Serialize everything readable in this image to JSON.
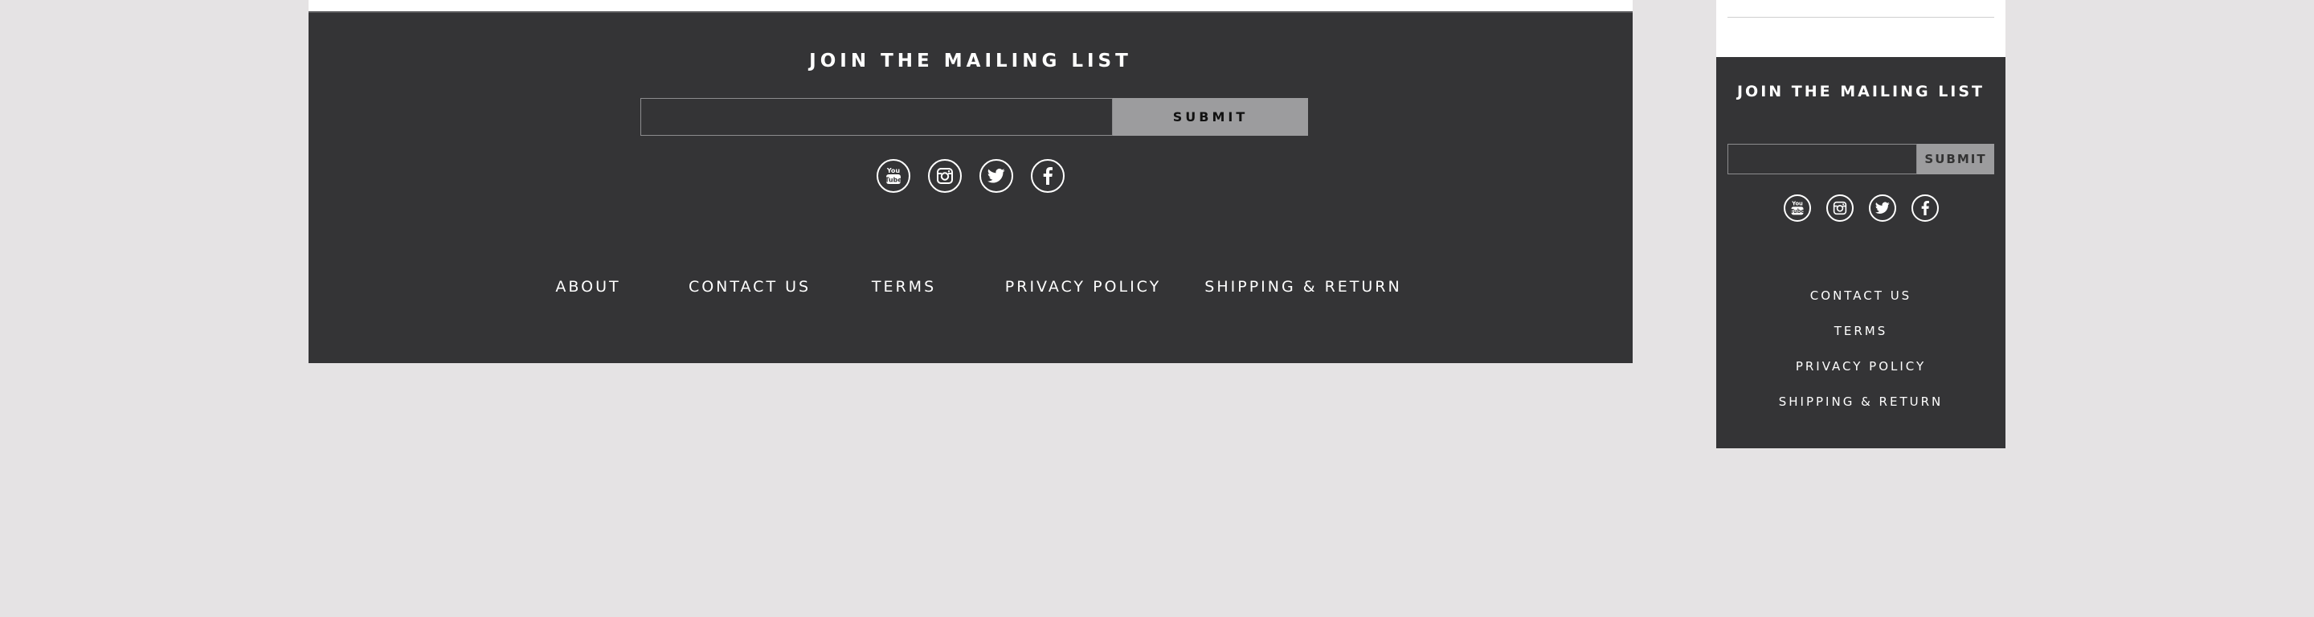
{
  "desktop_footer": {
    "mailing_title": "JOIN THE MAILING LIST",
    "email_input": {
      "value": "",
      "placeholder": ""
    },
    "submit_label": "SUBMIT",
    "socials": [
      {
        "icon": "youtube-icon"
      },
      {
        "icon": "instagram-icon"
      },
      {
        "icon": "twitter-icon"
      },
      {
        "icon": "facebook-icon"
      }
    ],
    "nav": [
      {
        "label": "ABOUT"
      },
      {
        "label": "CONTACT US"
      },
      {
        "label": "TERMS"
      },
      {
        "label": "PRIVACY POLICY"
      },
      {
        "label": "SHIPPING & RETURN"
      }
    ]
  },
  "mobile_footer": {
    "mailing_title": "JOIN THE MAILING LIST",
    "email_input": {
      "value": "",
      "placeholder": ""
    },
    "submit_label": "SUBMIT",
    "socials": [
      {
        "icon": "youtube-icon"
      },
      {
        "icon": "instagram-icon"
      },
      {
        "icon": "twitter-icon"
      },
      {
        "icon": "facebook-icon"
      }
    ],
    "nav": [
      {
        "label": "CONTACT US"
      },
      {
        "label": "TERMS"
      },
      {
        "label": "PRIVACY POLICY"
      },
      {
        "label": "SHIPPING & RETURN"
      }
    ]
  },
  "colors": {
    "page_background": "#e5e3e4",
    "footer_background": "#343436",
    "submit_background": "#9c9c9e",
    "text": "#ffffff"
  }
}
